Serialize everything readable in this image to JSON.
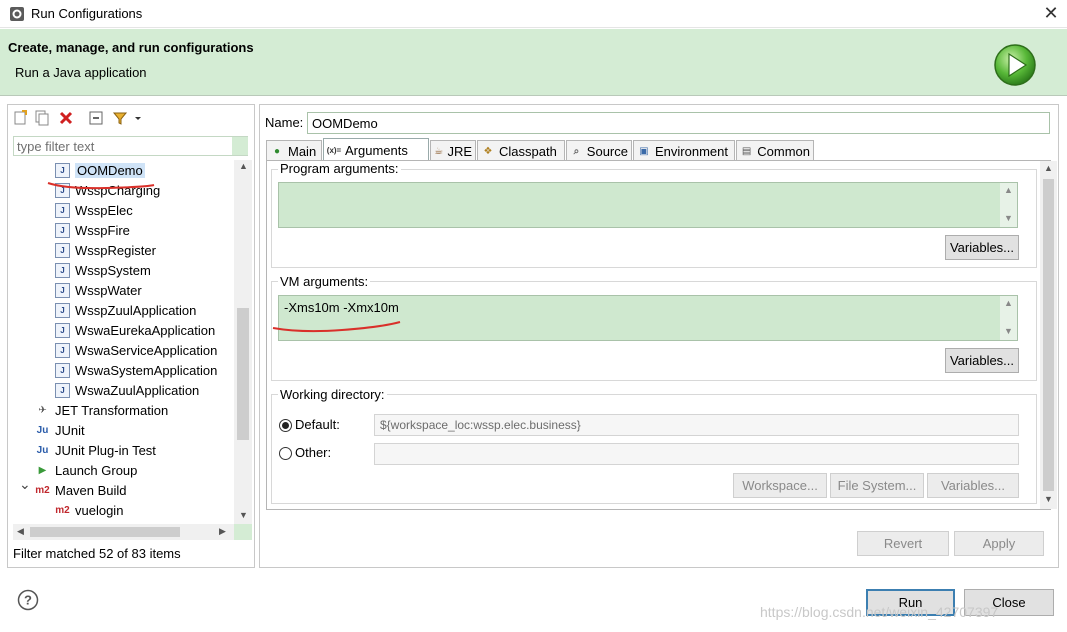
{
  "window": {
    "title": "Run Configurations",
    "close_glyph": "✕"
  },
  "banner": {
    "title": "Create, manage, and run configurations",
    "subtitle": "Run a Java application"
  },
  "left": {
    "toolbar_icons": [
      "new-config-icon",
      "duplicate-icon",
      "delete-icon",
      "collapse-all-icon",
      "filter-icon",
      "dropdown-icon"
    ],
    "filter_placeholder": "type filter text",
    "tree": [
      {
        "label": "OOMDemo",
        "icon": "J",
        "level": 2,
        "selected": true
      },
      {
        "label": "WsspCharging",
        "icon": "J",
        "level": 2
      },
      {
        "label": "WsspElec",
        "icon": "J",
        "level": 2
      },
      {
        "label": "WsspFire",
        "icon": "J",
        "level": 2
      },
      {
        "label": "WsspRegister",
        "icon": "J",
        "level": 2
      },
      {
        "label": "WsspSystem",
        "icon": "J",
        "level": 2
      },
      {
        "label": "WsspWater",
        "icon": "J",
        "level": 2
      },
      {
        "label": "WsspZuulApplication",
        "icon": "J",
        "level": 2
      },
      {
        "label": "WswaEurekaApplication",
        "icon": "J",
        "level": 2
      },
      {
        "label": "WswaServiceApplication",
        "icon": "J",
        "level": 2
      },
      {
        "label": "WswaSystemApplication",
        "icon": "J",
        "level": 2
      },
      {
        "label": "WswaZuulApplication",
        "icon": "J",
        "level": 2
      },
      {
        "label": "JET Transformation",
        "icon": "jet",
        "level": 1
      },
      {
        "label": "JUnit",
        "icon": "Ju",
        "level": 1
      },
      {
        "label": "JUnit Plug-in Test",
        "icon": "Ju",
        "level": 1
      },
      {
        "label": "Launch Group",
        "icon": "launch",
        "level": 1
      },
      {
        "label": "Maven Build",
        "icon": "m2",
        "level": 1,
        "expanded": true
      },
      {
        "label": "vuelogin",
        "icon": "m2",
        "level": 2
      }
    ],
    "filter_status": "Filter matched 52 of 83 items"
  },
  "right": {
    "name_label": "Name:",
    "name_value": "OOMDemo",
    "tabs": [
      {
        "label": "Main",
        "icon": "main-tab-icon",
        "active": false
      },
      {
        "label": "Arguments",
        "icon": "arguments-tab-icon",
        "active": true
      },
      {
        "label": "JRE",
        "icon": "jre-tab-icon",
        "active": false
      },
      {
        "label": "Classpath",
        "icon": "classpath-tab-icon",
        "active": false
      },
      {
        "label": "Source",
        "icon": "source-tab-icon",
        "active": false
      },
      {
        "label": "Environment",
        "icon": "environment-tab-icon",
        "active": false
      },
      {
        "label": "Common",
        "icon": "common-tab-icon",
        "active": false
      }
    ],
    "program_args": {
      "label": "Program arguments:",
      "value": "",
      "variables_button": "Variables..."
    },
    "vm_args": {
      "label": "VM arguments:",
      "value": "-Xms10m -Xmx10m",
      "variables_button": "Variables..."
    },
    "working_dir": {
      "label": "Working directory:",
      "default_label": "Default:",
      "default_value": "${workspace_loc:wssp.elec.business}",
      "other_label": "Other:",
      "other_value": "",
      "workspace_button": "Workspace...",
      "filesystem_button": "File System...",
      "variables_button": "Variables..."
    },
    "revert_button": "Revert",
    "apply_button": "Apply"
  },
  "footer": {
    "run_button": "Run",
    "close_button": "Close",
    "watermark": "https://blog.csdn.net/weixin_42707397"
  },
  "colors": {
    "banner_bg": "#d4ecd4",
    "field_green": "#cfe8cf",
    "annotation_red": "#d9302a"
  }
}
